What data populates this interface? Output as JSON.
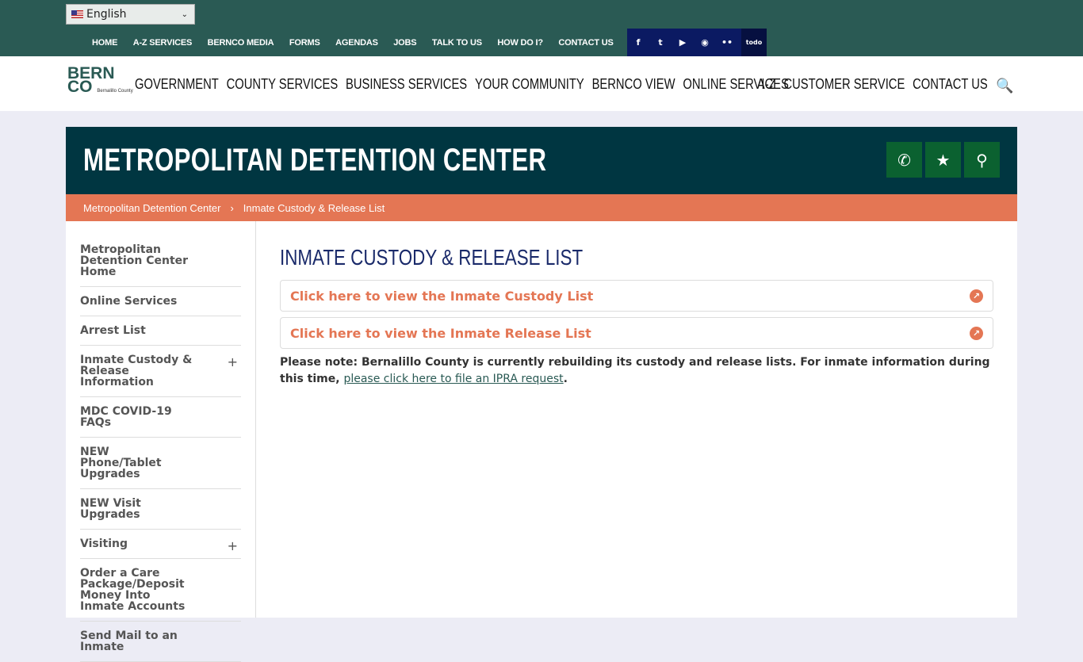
{
  "language": "English",
  "utility_nav": [
    "HOME",
    "A-Z SERVICES",
    "BERNCO MEDIA",
    "FORMS",
    "AGENDAS",
    "JOBS",
    "TALK TO US",
    "HOW DO I?",
    "CONTACT US"
  ],
  "social": [
    "facebook-icon",
    "twitter-icon",
    "youtube-icon",
    "instagram-icon",
    "flickr-icon",
    "abq-todo-icon"
  ],
  "logo": {
    "line1": "BERN",
    "line2": "CO",
    "sub": "Bernalillo County"
  },
  "main_nav": [
    "GOVERNMENT",
    "COUNTY SERVICES",
    "BUSINESS SERVICES",
    "YOUR COMMUNITY",
    "BERNCO VIEW",
    "ONLINE SERVICES"
  ],
  "right_nav": [
    "A-Z",
    "CUSTOMER SERVICE",
    "CONTACT US"
  ],
  "banner_title": "METROPOLITAN DETENTION CENTER",
  "breadcrumb": [
    "Metropolitan Detention Center",
    "Inmate Custody & Release List"
  ],
  "sidebar": [
    {
      "label": "Metropolitan Detention Center Home"
    },
    {
      "label": "Online Services"
    },
    {
      "label": "Arrest List"
    },
    {
      "label": "Inmate Custody & Release Information",
      "expandable": true
    },
    {
      "label": "MDC COVID-19 FAQs"
    },
    {
      "label": "NEW Phone/Tablet Upgrades"
    },
    {
      "label": "NEW Visit Upgrades"
    },
    {
      "label": "Visiting",
      "expandable": true
    },
    {
      "label": "Order a Care Package/Deposit Money Into Inmate Accounts"
    },
    {
      "label": "Send Mail to an Inmate"
    }
  ],
  "page_title": "INMATE CUSTODY & RELEASE LIST",
  "links": [
    "Click here to view the Inmate Custody List",
    "Click here to view the Inmate Release List"
  ],
  "note": {
    "text": "Please note: Bernalillo County is currently rebuilding its custody and release lists. For inmate information during this time, ",
    "link": "please click here to file an IPRA request",
    "end": "."
  }
}
